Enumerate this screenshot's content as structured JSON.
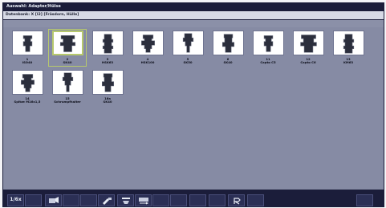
{
  "window": {
    "title": "Auswahl: Adapter/Hülse"
  },
  "path": {
    "text": "Datenbank: X [I2] [Fräsdorn, Hülle]"
  },
  "adapters": [
    {
      "num": "1",
      "label": "ISO40",
      "selected": false
    },
    {
      "num": "2",
      "label": "SK40",
      "selected": true
    },
    {
      "num": "3",
      "label": "HSK63",
      "selected": false
    },
    {
      "num": "4",
      "label": "HSK100",
      "selected": false
    },
    {
      "num": "5",
      "label": "SK50",
      "selected": false
    },
    {
      "num": "6",
      "label": "SK40",
      "selected": false
    },
    {
      "num": "11",
      "label": "Capto C5",
      "selected": false
    },
    {
      "num": "12",
      "label": "Capto C6",
      "selected": false
    },
    {
      "num": "13",
      "label": "KM63",
      "selected": false
    },
    {
      "num": "14",
      "label": "Spitze M16x1,5",
      "selected": false
    },
    {
      "num": "15",
      "label": "Schrumpfhalter",
      "selected": false
    },
    {
      "num": "16a",
      "label": "SK40",
      "selected": false
    }
  ],
  "softkeys": [
    {
      "name": "softkey-1",
      "label": "1/6x"
    },
    {
      "name": "softkey-2",
      "label": ""
    },
    {
      "name": "softkey-3",
      "label": ""
    },
    {
      "name": "softkey-4",
      "label": ""
    },
    {
      "name": "softkey-5",
      "label": ""
    },
    {
      "name": "softkey-6",
      "label": ""
    },
    {
      "name": "softkey-7",
      "label": ""
    },
    {
      "name": "softkey-8",
      "label": ""
    },
    {
      "name": "softkey-9",
      "label": ""
    },
    {
      "name": "softkey-10",
      "label": ""
    },
    {
      "name": "softkey-11",
      "label": ""
    },
    {
      "name": "softkey-12",
      "label": ""
    },
    {
      "name": "softkey-13",
      "label": ""
    },
    {
      "name": "softkey-14",
      "label": ""
    },
    {
      "name": "softkey-15",
      "label": ""
    }
  ],
  "colors": {
    "background": "#1b1d3a",
    "content": "#868ba4",
    "selection": "#b7c96c"
  }
}
